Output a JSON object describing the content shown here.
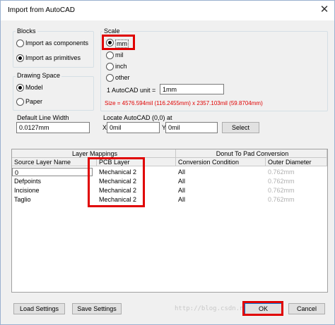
{
  "window": {
    "title": "Import from AutoCAD",
    "close_glyph": "✕"
  },
  "blocks": {
    "label": "Blocks",
    "options": [
      "Import as components",
      "Import as primitives"
    ],
    "selected": "Import as primitives"
  },
  "drawing_space": {
    "label": "Drawing Space",
    "options": [
      "Model",
      "Paper"
    ],
    "selected": "Model"
  },
  "scale": {
    "label": "Scale",
    "options": [
      "mm",
      "mil",
      "inch",
      "other"
    ],
    "selected": "mm",
    "unit_label": "1 AutoCAD unit =",
    "unit_value": "1mm",
    "size_text": "Size = 4576.594mil (116.2455mm) x 2357.103mil (59.8704mm)"
  },
  "default_line_width": {
    "label": "Default Line Width",
    "value": "0.0127mm"
  },
  "locate": {
    "label": "Locate AutoCAD (0,0) at",
    "x_label": "X",
    "x_value": "0mil",
    "y_label": "Y",
    "y_value": "0mil",
    "select_label": "Select"
  },
  "table": {
    "group_headers": [
      "Layer Mappings",
      "Donut To Pad Conversion"
    ],
    "columns": [
      "Source Layer Name",
      "PCB Layer",
      "Conversion Condition",
      "Outer Diameter"
    ],
    "rows": [
      {
        "source": "0",
        "pcb": "Mechanical 2",
        "condition": "All",
        "diameter": "0.762mm"
      },
      {
        "source": "Defpoints",
        "pcb": "Mechanical 2",
        "condition": "All",
        "diameter": "0.762mm"
      },
      {
        "source": "Incisione",
        "pcb": "Mechanical 2",
        "condition": "All",
        "diameter": "0.762mm"
      },
      {
        "source": "Taglio",
        "pcb": "Mechanical 2",
        "condition": "All",
        "diameter": "0.762mm"
      }
    ]
  },
  "buttons": {
    "load_settings": "Load Settings",
    "save_settings": "Save Settings",
    "ok": "OK",
    "cancel": "Cancel"
  },
  "watermark": "http://blog.csdn.net/..."
}
